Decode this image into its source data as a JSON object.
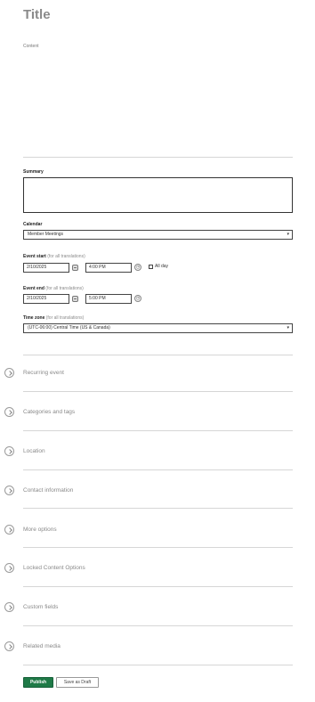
{
  "form": {
    "title_placeholder": "Title",
    "content_label": "Content",
    "summary_label": "Summary",
    "calendar_label": "Calendar",
    "calendar_value": "Member Meetings",
    "event_start_label": "Event start",
    "event_start_hint": "(for all translations)",
    "event_start_date": "2/10/2025",
    "event_start_time": "4:00 PM",
    "all_day_label": "All day",
    "event_end_label": "Event end",
    "event_end_hint": "(for all translations)",
    "event_end_date": "2/10/2025",
    "event_end_time": "5:00 PM",
    "timezone_label": "Time zone",
    "timezone_hint": "(for all translations)",
    "timezone_value": "(UTC-06:00) Central Time (US & Canada)"
  },
  "sections": [
    {
      "label": "Recurring event"
    },
    {
      "label": "Categories and tags"
    },
    {
      "label": "Location"
    },
    {
      "label": "Contact information"
    },
    {
      "label": "More options"
    },
    {
      "label": "Locked Content Options"
    },
    {
      "label": "Custom fields"
    },
    {
      "label": "Related media"
    }
  ],
  "actions": {
    "publish_label": "Publish",
    "draft_label": "Save as Draft"
  },
  "colors": {
    "publish_bg": "#1f7a47",
    "section_text": "#8a8a8a"
  }
}
